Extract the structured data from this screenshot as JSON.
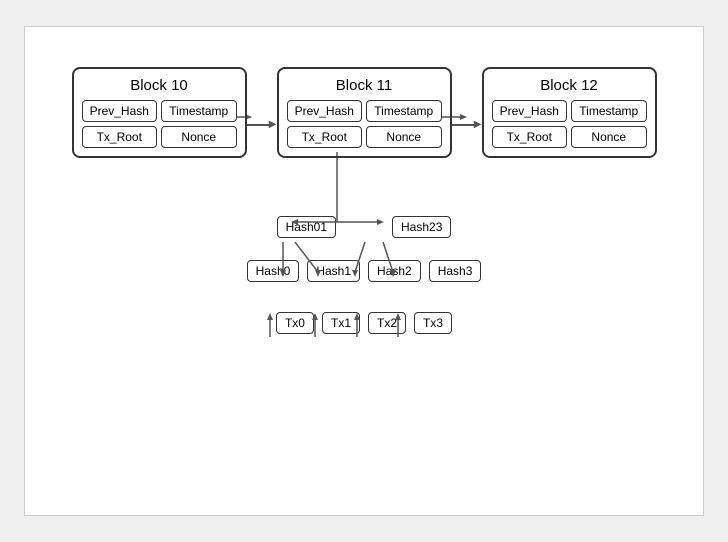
{
  "diagram": {
    "blocks": [
      {
        "id": "block10",
        "title": "Block 10",
        "fields": [
          "Prev_Hash",
          "Timestamp",
          "Tx_Root",
          "Nonce"
        ]
      },
      {
        "id": "block11",
        "title": "Block 11",
        "fields": [
          "Prev_Hash",
          "Timestamp",
          "Tx_Root",
          "Nonce"
        ]
      },
      {
        "id": "block12",
        "title": "Block 12",
        "fields": [
          "Prev_Hash",
          "Timestamp",
          "Tx_Root",
          "Nonce"
        ]
      }
    ],
    "merkle": {
      "level2": [
        "Hash01",
        "Hash23"
      ],
      "level1": [
        "Hash0",
        "Hash1",
        "Hash2",
        "Hash3"
      ],
      "level0": [
        "Tx0",
        "Tx1",
        "Tx2",
        "Tx3"
      ]
    }
  }
}
